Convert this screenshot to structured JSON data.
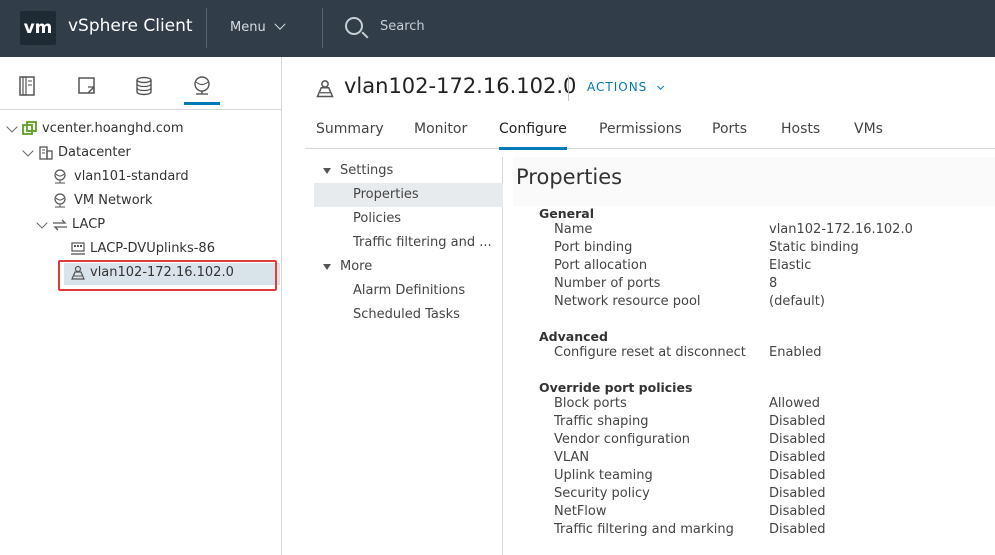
{
  "header": {
    "logo": "vm",
    "app_title": "vSphere Client",
    "menu_label": "Menu",
    "search_placeholder": "Search"
  },
  "nav_icons": [
    "hosts-clusters-icon",
    "vms-templates-icon",
    "storage-icon",
    "networking-icon"
  ],
  "tree": {
    "vcenter": "vcenter.hoanghd.com",
    "datacenter": "Datacenter",
    "items": [
      "vlan101-standard",
      "VM Network"
    ],
    "folder": "LACP",
    "dvuplinks": "LACP-DVUplinks-86",
    "selected": "vlan102-172.16.102.0"
  },
  "object": {
    "title": "vlan102-172.16.102.0",
    "actions_label": "ACTIONS"
  },
  "tabs": [
    "Summary",
    "Monitor",
    "Configure",
    "Permissions",
    "Ports",
    "Hosts",
    "VMs"
  ],
  "active_tab": "Configure",
  "subnav": {
    "settings_label": "Settings",
    "settings_items": [
      "Properties",
      "Policies",
      "Traffic filtering and ..."
    ],
    "more_label": "More",
    "more_items": [
      "Alarm Definitions",
      "Scheduled Tasks"
    ]
  },
  "content": {
    "title": "Properties",
    "general": {
      "heading": "General",
      "rows": [
        [
          "Name",
          "vlan102-172.16.102.0"
        ],
        [
          "Port binding",
          "Static binding"
        ],
        [
          "Port allocation",
          "Elastic"
        ],
        [
          "Number of ports",
          "8"
        ],
        [
          "Network resource pool",
          "(default)"
        ]
      ]
    },
    "advanced": {
      "heading": "Advanced",
      "rows": [
        [
          "Configure reset at disconnect",
          "Enabled"
        ]
      ]
    },
    "override": {
      "heading": "Override port policies",
      "rows": [
        [
          "Block ports",
          "Allowed"
        ],
        [
          "Traffic shaping",
          "Disabled"
        ],
        [
          "Vendor configuration",
          "Disabled"
        ],
        [
          "VLAN",
          "Disabled"
        ],
        [
          "Uplink teaming",
          "Disabled"
        ],
        [
          "Security policy",
          "Disabled"
        ],
        [
          "NetFlow",
          "Disabled"
        ],
        [
          "Traffic filtering and marking",
          "Disabled"
        ]
      ]
    }
  },
  "colors": {
    "header_bg": "#313d48",
    "accent": "#0079b8",
    "highlight": "#e03a3a"
  }
}
